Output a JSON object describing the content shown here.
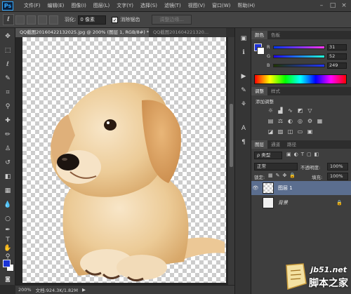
{
  "app": {
    "logo": "Ps"
  },
  "menu": [
    "文件(F)",
    "编辑(E)",
    "图像(I)",
    "图层(L)",
    "文字(Y)",
    "选择(S)",
    "滤镜(T)",
    "视图(V)",
    "窗口(W)",
    "帮助(H)"
  ],
  "window_controls": [
    "–",
    "□",
    "×"
  ],
  "options": {
    "feather_label": "羽化:",
    "feather_value": "0 像素",
    "antialias_label": "消除锯齿",
    "refine_button": "调整边缘..."
  },
  "doc_tabs": [
    "QQ截图20160422132025.jpg @ 200% (图层 1, RGB/8#) * ×",
    "QQ截图201604221320..."
  ],
  "status": {
    "zoom": "200%",
    "doc": "文档:924.3K/1.82M"
  },
  "color_panel": {
    "tabs": [
      "颜色",
      "色板"
    ],
    "colors": {
      "foreground": "#1f33d6",
      "accent": "#31a8ff"
    },
    "channels": [
      {
        "label": "R",
        "value": "31"
      },
      {
        "label": "G",
        "value": "52"
      },
      {
        "label": "B",
        "value": "249"
      }
    ]
  },
  "adjust_panel": {
    "tabs": [
      "调整",
      "样式"
    ],
    "add_label": "添加调整"
  },
  "layers_panel": {
    "tabs": [
      "图层",
      "通道",
      "路径"
    ],
    "kind_label": "ρ 类型",
    "blend_mode": "正常",
    "opacity_label": "不透明度:",
    "opacity_value": "100%",
    "lock_label": "锁定:",
    "fill_label": "填充:",
    "fill_value": "100%",
    "layers": [
      {
        "name": "图层 1"
      },
      {
        "name": "背景"
      }
    ]
  },
  "watermark": {
    "url": "jb51.net",
    "site": "脚本之家"
  }
}
